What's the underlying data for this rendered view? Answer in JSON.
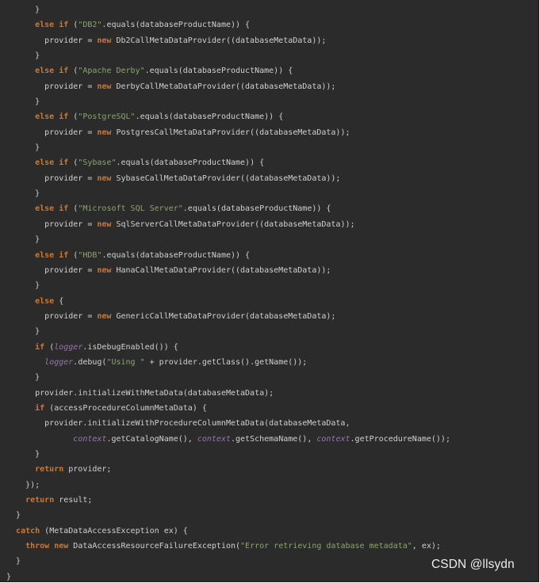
{
  "code": {
    "lines": [
      [
        {
          "t": "      }",
          "c": "pln"
        }
      ],
      [
        {
          "t": "      ",
          "c": "pln"
        },
        {
          "t": "else if",
          "c": "kw"
        },
        {
          "t": " (",
          "c": "pln"
        },
        {
          "t": "\"DB2\"",
          "c": "str"
        },
        {
          "t": ".equals(databaseProductName)) {",
          "c": "pln"
        }
      ],
      [
        {
          "t": "        provider = ",
          "c": "pln"
        },
        {
          "t": "new",
          "c": "kw"
        },
        {
          "t": " Db2CallMetaDataProvider((databaseMetaData));",
          "c": "pln"
        }
      ],
      [
        {
          "t": "      }",
          "c": "pln"
        }
      ],
      [
        {
          "t": "      ",
          "c": "pln"
        },
        {
          "t": "else if",
          "c": "kw"
        },
        {
          "t": " (",
          "c": "pln"
        },
        {
          "t": "\"Apache Derby\"",
          "c": "str"
        },
        {
          "t": ".equals(databaseProductName)) {",
          "c": "pln"
        }
      ],
      [
        {
          "t": "        provider = ",
          "c": "pln"
        },
        {
          "t": "new",
          "c": "kw"
        },
        {
          "t": " DerbyCallMetaDataProvider((databaseMetaData));",
          "c": "pln"
        }
      ],
      [
        {
          "t": "      }",
          "c": "pln"
        }
      ],
      [
        {
          "t": "      ",
          "c": "pln"
        },
        {
          "t": "else if",
          "c": "kw"
        },
        {
          "t": " (",
          "c": "pln"
        },
        {
          "t": "\"PostgreSQL\"",
          "c": "str"
        },
        {
          "t": ".equals(databaseProductName)) {",
          "c": "pln"
        }
      ],
      [
        {
          "t": "        provider = ",
          "c": "pln"
        },
        {
          "t": "new",
          "c": "kw"
        },
        {
          "t": " PostgresCallMetaDataProvider((databaseMetaData));",
          "c": "pln"
        }
      ],
      [
        {
          "t": "      }",
          "c": "pln"
        }
      ],
      [
        {
          "t": "      ",
          "c": "pln"
        },
        {
          "t": "else if",
          "c": "kw"
        },
        {
          "t": " (",
          "c": "pln"
        },
        {
          "t": "\"Sybase\"",
          "c": "str"
        },
        {
          "t": ".equals(databaseProductName)) {",
          "c": "pln"
        }
      ],
      [
        {
          "t": "        provider = ",
          "c": "pln"
        },
        {
          "t": "new",
          "c": "kw"
        },
        {
          "t": " SybaseCallMetaDataProvider((databaseMetaData));",
          "c": "pln"
        }
      ],
      [
        {
          "t": "      }",
          "c": "pln"
        }
      ],
      [
        {
          "t": "      ",
          "c": "pln"
        },
        {
          "t": "else if",
          "c": "kw"
        },
        {
          "t": " (",
          "c": "pln"
        },
        {
          "t": "\"Microsoft SQL Server\"",
          "c": "str"
        },
        {
          "t": ".equals(databaseProductName)) {",
          "c": "pln"
        }
      ],
      [
        {
          "t": "        provider = ",
          "c": "pln"
        },
        {
          "t": "new",
          "c": "kw"
        },
        {
          "t": " SqlServerCallMetaDataProvider((databaseMetaData));",
          "c": "pln"
        }
      ],
      [
        {
          "t": "      }",
          "c": "pln"
        }
      ],
      [
        {
          "t": "      ",
          "c": "pln"
        },
        {
          "t": "else if",
          "c": "kw"
        },
        {
          "t": " (",
          "c": "pln"
        },
        {
          "t": "\"HDB\"",
          "c": "str"
        },
        {
          "t": ".equals(databaseProductName)) {",
          "c": "pln"
        }
      ],
      [
        {
          "t": "        provider = ",
          "c": "pln"
        },
        {
          "t": "new",
          "c": "kw"
        },
        {
          "t": " HanaCallMetaDataProvider((databaseMetaData));",
          "c": "pln"
        }
      ],
      [
        {
          "t": "      }",
          "c": "pln"
        }
      ],
      [
        {
          "t": "      ",
          "c": "pln"
        },
        {
          "t": "else",
          "c": "kw"
        },
        {
          "t": " {",
          "c": "pln"
        }
      ],
      [
        {
          "t": "        provider = ",
          "c": "pln"
        },
        {
          "t": "new",
          "c": "kw"
        },
        {
          "t": " GenericCallMetaDataProvider(databaseMetaData);",
          "c": "pln"
        }
      ],
      [
        {
          "t": "      }",
          "c": "pln"
        }
      ],
      [
        {
          "t": "      ",
          "c": "pln"
        },
        {
          "t": "if",
          "c": "kw"
        },
        {
          "t": " (",
          "c": "pln"
        },
        {
          "t": "logger",
          "c": "fld"
        },
        {
          "t": ".isDebugEnabled()) {",
          "c": "pln"
        }
      ],
      [
        {
          "t": "        ",
          "c": "pln"
        },
        {
          "t": "logger",
          "c": "fld"
        },
        {
          "t": ".debug(",
          "c": "pln"
        },
        {
          "t": "\"Using \"",
          "c": "str"
        },
        {
          "t": " + provider.getClass().getName());",
          "c": "pln"
        }
      ],
      [
        {
          "t": "      }",
          "c": "pln"
        }
      ],
      [
        {
          "t": "      provider.initializeWithMetaData(databaseMetaData);",
          "c": "pln"
        }
      ],
      [
        {
          "t": "      ",
          "c": "pln"
        },
        {
          "t": "if",
          "c": "kw"
        },
        {
          "t": " (accessProcedureColumnMetaData) {",
          "c": "pln"
        }
      ],
      [
        {
          "t": "        provider.initializeWithProcedureColumnMetaData(databaseMetaData,",
          "c": "pln"
        }
      ],
      [
        {
          "t": "              ",
          "c": "pln"
        },
        {
          "t": "context",
          "c": "fld"
        },
        {
          "t": ".getCatalogName(), ",
          "c": "pln"
        },
        {
          "t": "context",
          "c": "fld"
        },
        {
          "t": ".getSchemaName(), ",
          "c": "pln"
        },
        {
          "t": "context",
          "c": "fld"
        },
        {
          "t": ".getProcedureName());",
          "c": "pln"
        }
      ],
      [
        {
          "t": "      }",
          "c": "pln"
        }
      ],
      [
        {
          "t": "      ",
          "c": "pln"
        },
        {
          "t": "return",
          "c": "kw"
        },
        {
          "t": " provider;",
          "c": "pln"
        }
      ],
      [
        {
          "t": "    });",
          "c": "pln"
        }
      ],
      [
        {
          "t": "    ",
          "c": "pln"
        },
        {
          "t": "return",
          "c": "kw"
        },
        {
          "t": " result;",
          "c": "pln"
        }
      ],
      [
        {
          "t": "  }",
          "c": "pln"
        }
      ],
      [
        {
          "t": "  ",
          "c": "pln"
        },
        {
          "t": "catch",
          "c": "kw"
        },
        {
          "t": " (MetaDataAccessException ex) {",
          "c": "pln"
        }
      ],
      [
        {
          "t": "    ",
          "c": "pln"
        },
        {
          "t": "throw new",
          "c": "kw"
        },
        {
          "t": " DataAccessResourceFailureException(",
          "c": "pln"
        },
        {
          "t": "\"Error retrieving database metadata\"",
          "c": "str"
        },
        {
          "t": ", ex);",
          "c": "pln"
        }
      ],
      [
        {
          "t": "  }",
          "c": "pln"
        }
      ],
      [
        {
          "t": "}",
          "c": "pln"
        }
      ]
    ]
  },
  "watermark": {
    "text": "CSDN @llsydn"
  },
  "colors": {
    "background": "#2b2b2b",
    "keyword": "#cc7832",
    "string": "#8aa56b",
    "field": "#9876aa",
    "plain": "#d0d0d0"
  }
}
